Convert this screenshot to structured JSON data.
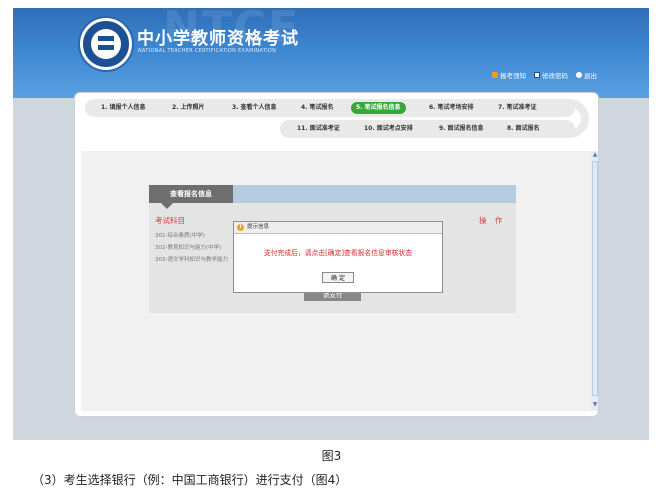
{
  "header": {
    "watermark": "NTCE",
    "title": "中小学教师资格考试",
    "subtitle": "NATIONAL TEACHER CERTIFICATION EXAMINATION",
    "links": [
      {
        "label": "报考须知",
        "icon": "bell-icon"
      },
      {
        "label": "修改密码",
        "icon": "edit-icon"
      },
      {
        "label": "退出",
        "icon": "exit-icon"
      }
    ]
  },
  "steps": {
    "row1": [
      "1. 填报个人信息",
      "2. 上传照片",
      "3. 查看个人信息",
      "4. 笔试报名",
      "5. 笔试报名信息",
      "6. 笔试考场安排",
      "7. 笔试准考证"
    ],
    "row2": [
      "11. 面试准考证",
      "10. 面试考点安排",
      "9. 面试报名信息",
      "8. 面试报名"
    ],
    "active": "5. 笔试报名信息"
  },
  "info": {
    "tab": "查看报名信息",
    "subject_header": "考试科目",
    "operation_header": "操 作",
    "subjects": [
      "301-综合素质(中学)",
      "302-教育知识与能力(中学)",
      "303-语文学科知识与教学能力"
    ],
    "pay_button": "请支付"
  },
  "dialog": {
    "title": "提示信息",
    "message": "支付完成后，请点击[确定]查看报名信息审核状态",
    "ok_button": "确 定"
  },
  "caption": {
    "figure": "图3",
    "paragraph": "（3）考生选择银行（例：中国工商银行）进行支付（图4）"
  },
  "colors": {
    "header_blue": "#3c86d0",
    "active_step": "#35a83a",
    "accent_red": "#d83a3a"
  }
}
